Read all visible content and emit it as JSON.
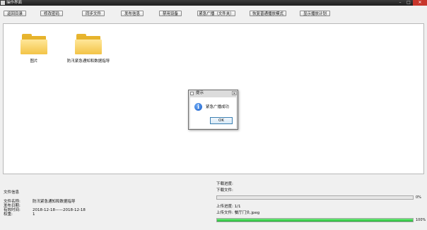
{
  "window": {
    "title": "操作界面"
  },
  "toolbar": {
    "buttons": [
      "返回目录",
      "修改密码",
      "同步文件",
      "发布信息",
      "禁用设备",
      "紧急广播（文件夹）",
      "恢复普通播放模式",
      "显示播放计划"
    ]
  },
  "folders": [
    {
      "label": "图片",
      "icon": "folder-icon"
    },
    {
      "label": "防汛紧急通知和数据指导",
      "icon": "folder-icon"
    }
  ],
  "dialog": {
    "title": "提示",
    "message": "紧急广播成功",
    "ok": "OK",
    "icon": "info-icon"
  },
  "file_info": {
    "heading": "文件信息",
    "rows": [
      {
        "key": "文件名称:",
        "value": "防汛紧急通知和数据指导"
      },
      {
        "key": "发布日期:",
        "value": ""
      },
      {
        "key": "有效时间:",
        "value": "2018-12-18——2018-12-18"
      },
      {
        "key": "权重:",
        "value": "1"
      }
    ]
  },
  "transfer": {
    "download_progress_label": "下载进度:",
    "download_file_label": "下载文件:",
    "download_percent": "0%",
    "download_fraction": 0,
    "upload_progress_label": "上传进度:  1/1",
    "upload_file_label": "上传文件:  餐厅门头.jpeg",
    "upload_percent": "100%",
    "upload_fraction": 1
  }
}
